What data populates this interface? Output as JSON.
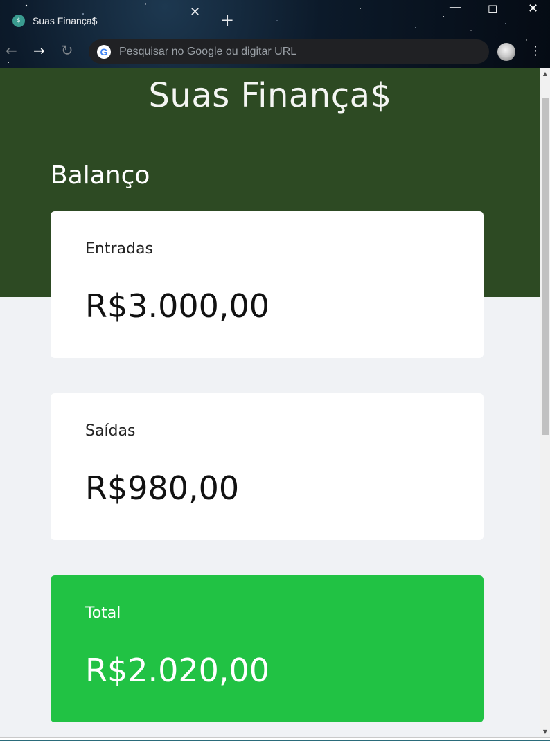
{
  "browser": {
    "tab": {
      "title": "Suas Finança$",
      "favicon": "money-icon",
      "close_glyph": "✕"
    },
    "new_tab_glyph": "+",
    "window_controls": {
      "minimize_glyph": "—",
      "maximize_glyph": "☐",
      "close_glyph": "✕"
    },
    "nav": {
      "back_glyph": "←",
      "forward_glyph": "→",
      "reload_glyph": "↻"
    },
    "omnibox": {
      "placeholder": "Pesquisar no Google ou digitar URL",
      "engine_icon": "google-icon",
      "engine_letter": "G"
    },
    "menu_glyph": "⋮"
  },
  "app": {
    "logo": "Suas Finança$",
    "section_title": "Balanço",
    "cards": [
      {
        "label": "Entradas",
        "value": "R$3.000,00"
      },
      {
        "label": "Saídas",
        "value": "R$980,00"
      },
      {
        "label": "Total",
        "value": "R$2.020,00"
      }
    ]
  },
  "colors": {
    "header": "#2d4a23",
    "total_card": "#21c244",
    "page_bg": "#f0f2f5"
  }
}
